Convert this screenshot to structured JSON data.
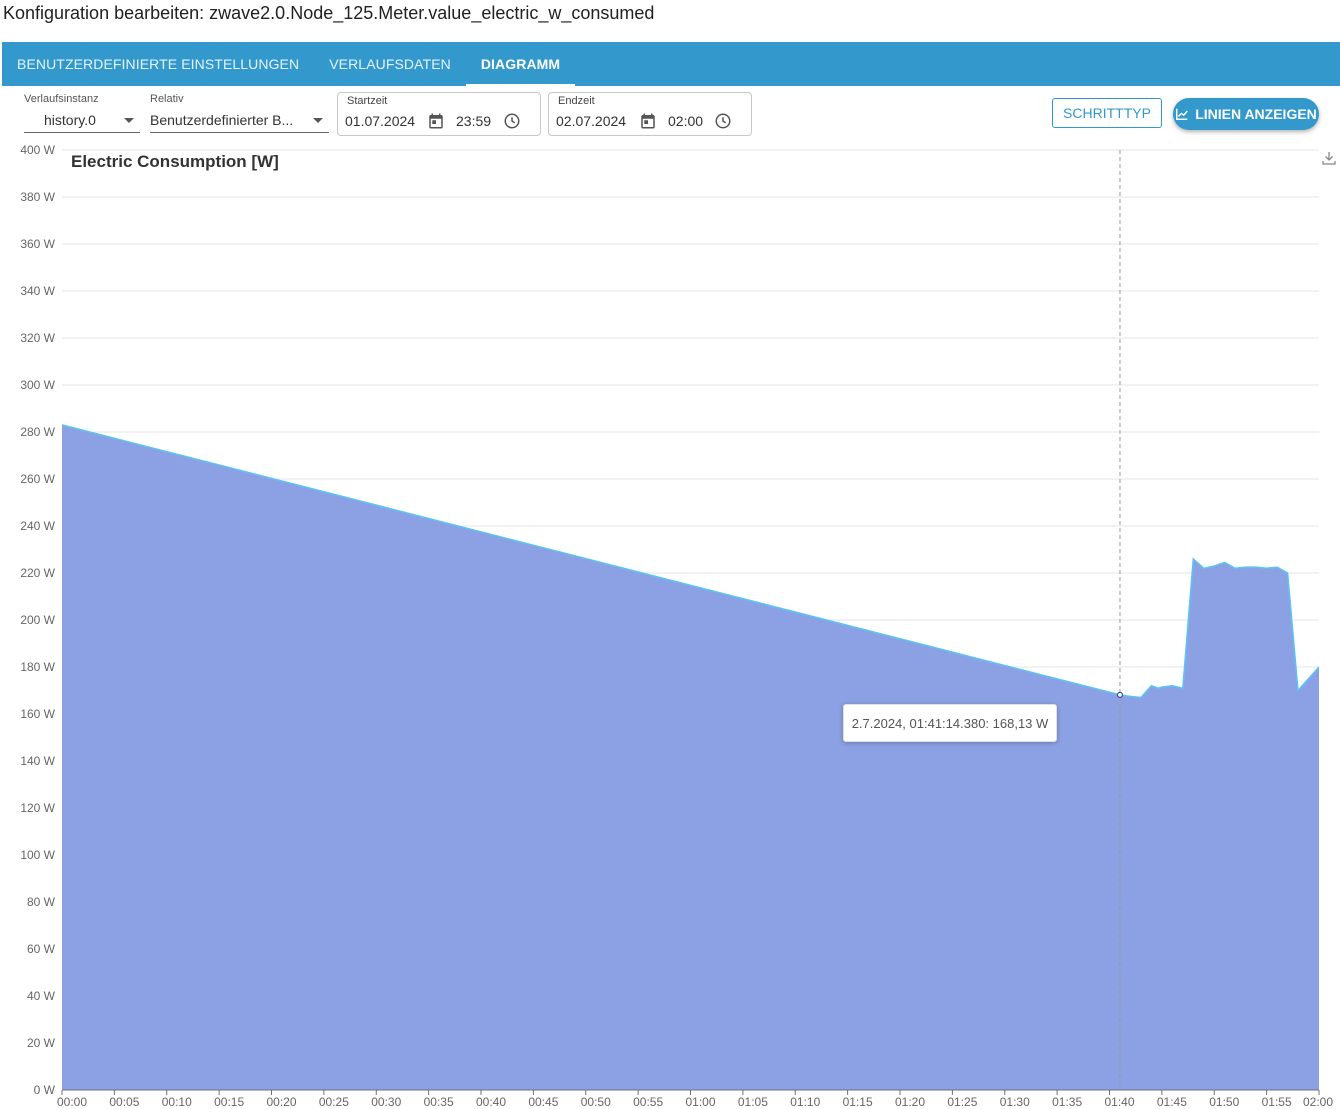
{
  "header": {
    "title": "Konfiguration bearbeiten: zwave2.0.Node_125.Meter.value_electric_w_consumed"
  },
  "tabs": [
    {
      "label": "BENUTZERDEFINIERTE EINSTELLUNGEN",
      "active": false
    },
    {
      "label": "VERLAUFSDATEN",
      "active": false
    },
    {
      "label": "DIAGRAMM",
      "active": true
    }
  ],
  "toolbar": {
    "instance": {
      "label": "Verlaufsinstanz",
      "value": "history.0"
    },
    "relative": {
      "label": "Relativ",
      "value": "Benutzerdefinierter B..."
    },
    "start": {
      "label": "Startzeit",
      "date": "01.07.2024",
      "time": "23:59"
    },
    "end": {
      "label": "Endzeit",
      "date": "02.07.2024",
      "time": "02:00"
    },
    "step_type_button": "SCHRITTTYP",
    "show_lines_button": "LINIEN ANZEIGEN"
  },
  "colors": {
    "accent": "#3399cc",
    "area_fill": "#8ca1e3",
    "area_line": "#5bc4f5"
  },
  "chart_data": {
    "type": "area",
    "title": "Electric Consumption [W]",
    "xlabel": "",
    "ylabel": "",
    "ylim": [
      0,
      400
    ],
    "y_ticks": [
      0,
      20,
      40,
      60,
      80,
      100,
      120,
      140,
      160,
      180,
      200,
      220,
      240,
      260,
      280,
      300,
      320,
      340,
      360,
      380,
      400
    ],
    "y_unit": "W",
    "x_ticks": [
      "00:00",
      "00:05",
      "00:10",
      "00:15",
      "00:20",
      "00:25",
      "00:30",
      "00:35",
      "00:40",
      "00:45",
      "00:50",
      "00:55",
      "01:00",
      "01:05",
      "01:10",
      "01:15",
      "01:20",
      "01:25",
      "01:30",
      "01:35",
      "01:40",
      "01:45",
      "01:50",
      "01:55",
      "02:00"
    ],
    "xlim": [
      "00:00",
      "02:00"
    ],
    "grid": true,
    "series": [
      {
        "x": [
          "00:00",
          "01:41",
          "01:42",
          "01:43",
          "01:44",
          "01:44:40",
          "01:45",
          "01:46",
          "01:47",
          "01:48",
          "01:49",
          "01:50",
          "01:51",
          "01:52",
          "01:53",
          "01:54",
          "01:55",
          "01:56",
          "01:57",
          "01:58",
          "01:59",
          "02:00"
        ],
        "values": [
          283,
          168.13,
          167.5,
          167,
          172,
          171,
          171.5,
          172,
          171,
          226,
          222,
          223,
          224.5,
          222,
          222.5,
          222.5,
          222,
          222.5,
          220,
          170,
          175,
          180
        ]
      }
    ],
    "crosshair_x": "01:41",
    "tooltip": "2.7.2024, 01:41:14.380: 168,13 W"
  }
}
